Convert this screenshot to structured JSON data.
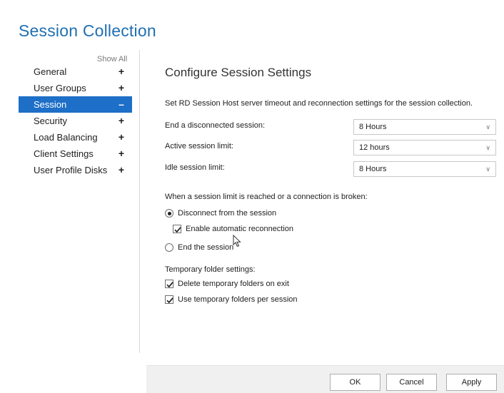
{
  "window": {
    "title": "Session Collection"
  },
  "sidebar": {
    "show_all_label": "Show All",
    "items": [
      {
        "label": "General",
        "sign": "+",
        "active": false
      },
      {
        "label": "User Groups",
        "sign": "+",
        "active": false
      },
      {
        "label": "Session",
        "sign": "–",
        "active": true
      },
      {
        "label": "Security",
        "sign": "+",
        "active": false
      },
      {
        "label": "Load Balancing",
        "sign": "+",
        "active": false
      },
      {
        "label": "Client Settings",
        "sign": "+",
        "active": false
      },
      {
        "label": "User Profile Disks",
        "sign": "+",
        "active": false
      }
    ]
  },
  "main": {
    "title": "Configure Session Settings",
    "description": "Set RD Session Host server timeout and reconnection settings for the session collection.",
    "settings": [
      {
        "label": "End a disconnected session:",
        "value": "8 Hours"
      },
      {
        "label": "Active session limit:",
        "value": "12 hours"
      },
      {
        "label": "Idle session limit:",
        "value": "8 Hours"
      }
    ],
    "limit_group_label": "When a session limit is reached or a connection is broken:",
    "disconnect_option": "Disconnect from the session",
    "reconnect_option": "Enable automatic reconnection",
    "end_option": "End the session",
    "temp_group_label": "Temporary folder settings:",
    "delete_temp_option": "Delete temporary folders on exit",
    "use_temp_option": "Use temporary folders per session"
  },
  "footer": {
    "ok_label": "OK",
    "cancel_label": "Cancel",
    "apply_label": "Apply"
  },
  "colors": {
    "title_blue": "#1f6fb2",
    "selection_blue": "#1e6fc7",
    "footer_bg": "#f0f0f0"
  },
  "icons": {
    "chevron": "chevron-down-icon",
    "checkmark": "checkmark-icon",
    "cursor": "mouse-cursor-icon"
  }
}
